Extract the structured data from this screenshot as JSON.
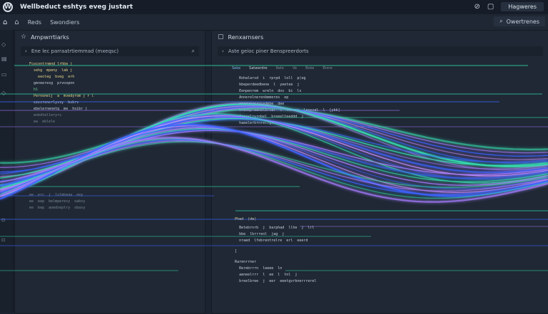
{
  "window": {
    "title": "Wellbeduct eshtys eveg justart",
    "action_button": "Hagweres"
  },
  "toolbar": {
    "items": [
      "Reds",
      "Swondiers"
    ],
    "search_label": "Owertrenes"
  },
  "left_panel": {
    "title": "Ampwrrtiarks",
    "subtitle": "Ene lec parraatrtiemmad (mxeqsc)",
    "code": [
      "  Fcocontrnmnd lrhbe j",
      "    sehg  mpeny  lab j",
      "      eeoleg  bveg  erh",
      "    geneeresg  prvoxpnn",
      "    hl",
      "    Pernonelj  a  mvedyrom j r l",
      "    ezesrenerlyvsy  bvbrv",
      "    ebelernenetg  me  hsibr j",
      "    enbdtelleryrs",
      "    ew  eblele",
      "  ee  erc  j  lulmbeaa  eey",
      "  ee  eep  belmperesy  oabsy",
      "  ee  bep  aoedseptry  obasy"
    ]
  },
  "right_panel": {
    "title": "Renxarnsers",
    "subtitle": "Aste geioc piner Benspreerdorts",
    "tabs": [
      "Seke",
      "Satwerdre",
      "Rete",
      "Ve",
      "Beke",
      "Brere"
    ],
    "code": [
      "        Rohalarsd  i  rprpd  loll  p(eg",
      "        bbeperdeedbene  l  yeetee  j",
      "        Eenpenrem  wreln  dos  bi  ls",
      "        Annerelnerenkmmeres  ep",
      "        aeeevnrnrgsedmbe  dee",
      "        hreobpreendlbrcer  l  rnrnna  lsoscel  l  [ybb]",
      "        Arerelrvrnbel  breeelteeddd  j",
      "        haeelerbrnrelrgvhs",
      "      Phed  (de)",
      "        Betebrnrb  j  barphad  llhe  j  lrl",
      "        bbe  lbrrrenl  jag  j",
      "        nraed  lfebrentrelre  erl  eeerd",
      "      ]",
      "      Rarenrrner",
      "        Rerebrrrn  leeee  ln",
      "        aeneelrrr  l  ee  l  tnl  j",
      "        breelbree  j  eer  eeetgvrbnerrrerel"
    ]
  },
  "wave_colors": {
    "green": "#35e0b0",
    "violet": "#a77bff",
    "blue": "#3c64ff",
    "pink": "#c890ff"
  },
  "icons": {
    "titlebar": [
      "wordpress-logo-icon",
      "help-icon",
      "document-icon"
    ],
    "toolbar": [
      "home-icon",
      "house-outline-icon",
      "search-icon"
    ],
    "panel": [
      "star-icon",
      "square-icon",
      "search-icon"
    ]
  }
}
